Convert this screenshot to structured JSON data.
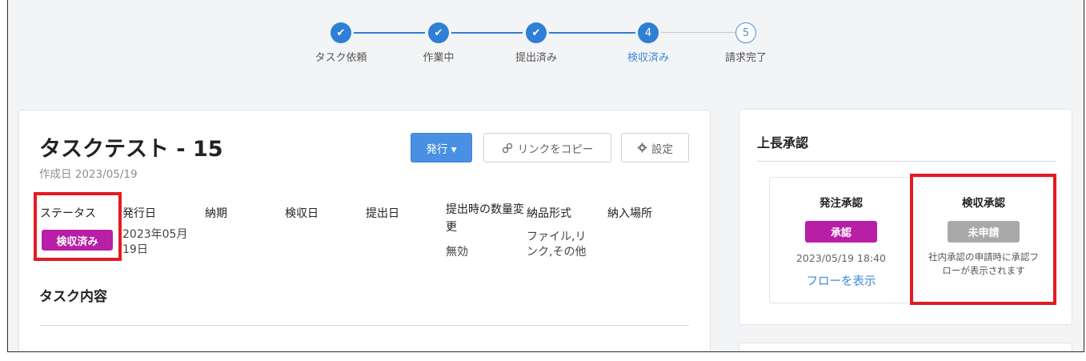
{
  "stepper": {
    "steps": [
      {
        "label": "タスク依頼",
        "state": "done",
        "number": "1"
      },
      {
        "label": "作業中",
        "state": "done",
        "number": "2"
      },
      {
        "label": "提出済み",
        "state": "done",
        "number": "3"
      },
      {
        "label": "検収済み",
        "state": "active",
        "number": "4"
      },
      {
        "label": "請求完了",
        "state": "pending",
        "number": "5"
      }
    ],
    "check_glyph": "✔"
  },
  "task": {
    "title": "タスクテスト - 15",
    "created": "作成日 2023/05/19",
    "issue_button": "発行 ▾",
    "copy_link_button": "リンクをコピー",
    "settings_button": "設定",
    "info_headers": {
      "status": "ステータス",
      "issue_date": "発行日",
      "due": "納期",
      "inspection_date": "検収日",
      "submit_date": "提出日",
      "qty_change": "提出時の数量変更",
      "delivery_format": "納品形式",
      "delivery_place": "納入場所"
    },
    "info_values": {
      "status_badge": "検収済み",
      "issue_date": "2023年05月19日",
      "qty_change": "無効",
      "delivery_format": "ファイル,リンク,その他"
    },
    "section_title": "タスク内容"
  },
  "side": {
    "title": "上長承認",
    "order_approval": {
      "title": "発注承認",
      "badge": "承認",
      "date": "2023/05/19 18:40",
      "link": "フローを表示"
    },
    "inspection_approval": {
      "title": "検収承認",
      "badge": "未申請",
      "note": "社内承認の申請時に承認フローが表示されます"
    }
  },
  "colors": {
    "accent": "#2f7fd6",
    "badge_magenta": "#b81fa6",
    "highlight_red": "#e21b23"
  }
}
